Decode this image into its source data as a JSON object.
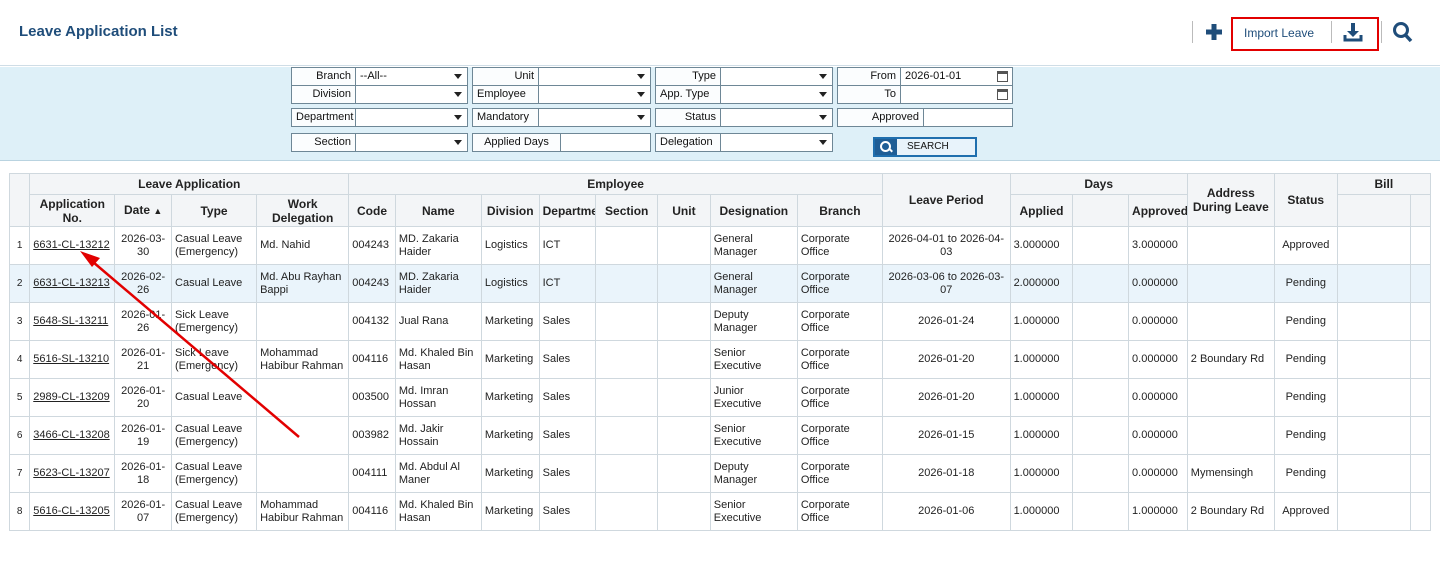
{
  "header": {
    "title": "Leave Application List",
    "import_label": "Import Leave",
    "icons": [
      "plus-icon",
      "download-icon",
      "search-icon"
    ]
  },
  "filters": {
    "branch_label": "Branch",
    "branch_value": "--All--",
    "unit_label": "Unit",
    "unit_value": "",
    "type_label": "Type",
    "type_value": "",
    "from_label": "From",
    "from_value": "2026-01-01",
    "division_label": "Division",
    "division_value": "",
    "employee_label": "Employee",
    "employee_value": "",
    "app_type_label": "App. Type",
    "app_type_value": "",
    "to_label": "To",
    "to_value": "",
    "department_label": "Department",
    "department_value": "",
    "mandatory_label": "Mandatory",
    "mandatory_value": "",
    "status_label": "Status",
    "status_value": "",
    "approved_label": "Approved",
    "approved_value": "",
    "section_label": "Section",
    "section_value": "",
    "applied_days_label": "Applied Days",
    "applied_days_value": "",
    "delegation_label": "Delegation",
    "delegation_value": "",
    "search_label": "SEARCH"
  },
  "table": {
    "group_headers": {
      "leave_application": "Leave Application",
      "employee": "Employee",
      "leave_period": "Leave Period",
      "days": "Days",
      "address": "Address During Leave",
      "status": "Status",
      "bill": "Bill"
    },
    "columns": {
      "app_no": "Application No.",
      "date": "Date",
      "type": "Type",
      "work_delegation": "Work Delegation",
      "code": "Code",
      "name": "Name",
      "division": "Division",
      "department": "Department",
      "section": "Section",
      "unit": "Unit",
      "designation": "Designation",
      "branch": "Branch",
      "applied": "Applied",
      "approved": "Approved"
    },
    "rows": [
      {
        "n": "1",
        "app_no": "6631-CL-13212",
        "date": "2026-03-30",
        "type": "Casual Leave (Emergency)",
        "delegation": "Md. Nahid",
        "code": "004243",
        "name": "MD. Zakaria Haider",
        "division": "Logistics",
        "department": "ICT",
        "section": "",
        "unit": "",
        "designation": "General Manager",
        "branch": "Corporate Office",
        "period": "2026-04-01 to 2026-04-03",
        "applied": "3.000000",
        "approved": "3.000000",
        "address": "",
        "status": "Approved"
      },
      {
        "n": "2",
        "app_no": "6631-CL-13213",
        "date": "2026-02-26",
        "type": "Casual Leave",
        "delegation": "Md. Abu Rayhan Bappi",
        "code": "004243",
        "name": "MD. Zakaria Haider",
        "division": "Logistics",
        "department": "ICT",
        "section": "",
        "unit": "",
        "designation": "General Manager",
        "branch": "Corporate Office",
        "period": "2026-03-06 to 2026-03-07",
        "applied": "2.000000",
        "approved": "0.000000",
        "address": "",
        "status": "Pending"
      },
      {
        "n": "3",
        "app_no": "5648-SL-13211",
        "date": "2026-01-26",
        "type": "Sick Leave (Emergency)",
        "delegation": "",
        "code": "004132",
        "name": "Jual Rana",
        "division": "Marketing",
        "department": "Sales",
        "section": "",
        "unit": "",
        "designation": "Deputy Manager",
        "branch": "Corporate Office",
        "period": "2026-01-24",
        "applied": "1.000000",
        "approved": "0.000000",
        "address": "",
        "status": "Pending"
      },
      {
        "n": "4",
        "app_no": "5616-SL-13210",
        "date": "2026-01-21",
        "type": "Sick Leave (Emergency)",
        "delegation": "Mohammad Habibur Rahman",
        "code": "004116",
        "name": "Md. Khaled Bin Hasan",
        "division": "Marketing",
        "department": "Sales",
        "section": "",
        "unit": "",
        "designation": "Senior Executive",
        "branch": "Corporate Office",
        "period": "2026-01-20",
        "applied": "1.000000",
        "approved": "0.000000",
        "address": "2 Boundary Rd",
        "status": "Pending"
      },
      {
        "n": "5",
        "app_no": "2989-CL-13209",
        "date": "2026-01-20",
        "type": "Casual Leave",
        "delegation": "",
        "code": "003500",
        "name": "Md. Imran Hossan",
        "division": "Marketing",
        "department": "Sales",
        "section": "",
        "unit": "",
        "designation": "Junior Executive",
        "branch": "Corporate Office",
        "period": "2026-01-20",
        "applied": "1.000000",
        "approved": "0.000000",
        "address": "",
        "status": "Pending"
      },
      {
        "n": "6",
        "app_no": "3466-CL-13208",
        "date": "2026-01-19",
        "type": "Casual Leave (Emergency)",
        "delegation": "",
        "code": "003982",
        "name": "Md. Jakir Hossain",
        "division": "Marketing",
        "department": "Sales",
        "section": "",
        "unit": "",
        "designation": "Senior Executive",
        "branch": "Corporate Office",
        "period": "2026-01-15",
        "applied": "1.000000",
        "approved": "0.000000",
        "address": "",
        "status": "Pending"
      },
      {
        "n": "7",
        "app_no": "5623-CL-13207",
        "date": "2026-01-18",
        "type": "Casual Leave (Emergency)",
        "delegation": "",
        "code": "004111",
        "name": "Md. Abdul Al Maner",
        "division": "Marketing",
        "department": "Sales",
        "section": "",
        "unit": "",
        "designation": "Deputy Manager",
        "branch": "Corporate Office",
        "period": "2026-01-18",
        "applied": "1.000000",
        "approved": "0.000000",
        "address": "Mymensingh",
        "status": "Pending"
      },
      {
        "n": "8",
        "app_no": "5616-CL-13205",
        "date": "2026-01-07",
        "type": "Casual Leave (Emergency)",
        "delegation": "Mohammad Habibur Rahman",
        "code": "004116",
        "name": "Md. Khaled Bin Hasan",
        "division": "Marketing",
        "department": "Sales",
        "section": "",
        "unit": "",
        "designation": "Senior Executive",
        "branch": "Corporate Office",
        "period": "2026-01-06",
        "applied": "1.000000",
        "approved": "1.000000",
        "address": "2 Boundary Rd",
        "status": "Approved"
      }
    ]
  },
  "colors": {
    "title": "#1f4d7a",
    "filter_bg": "#def0f8",
    "highlight_box": "#e20000",
    "arrow": "#e20000",
    "selected_row": "#eaf4fb"
  }
}
